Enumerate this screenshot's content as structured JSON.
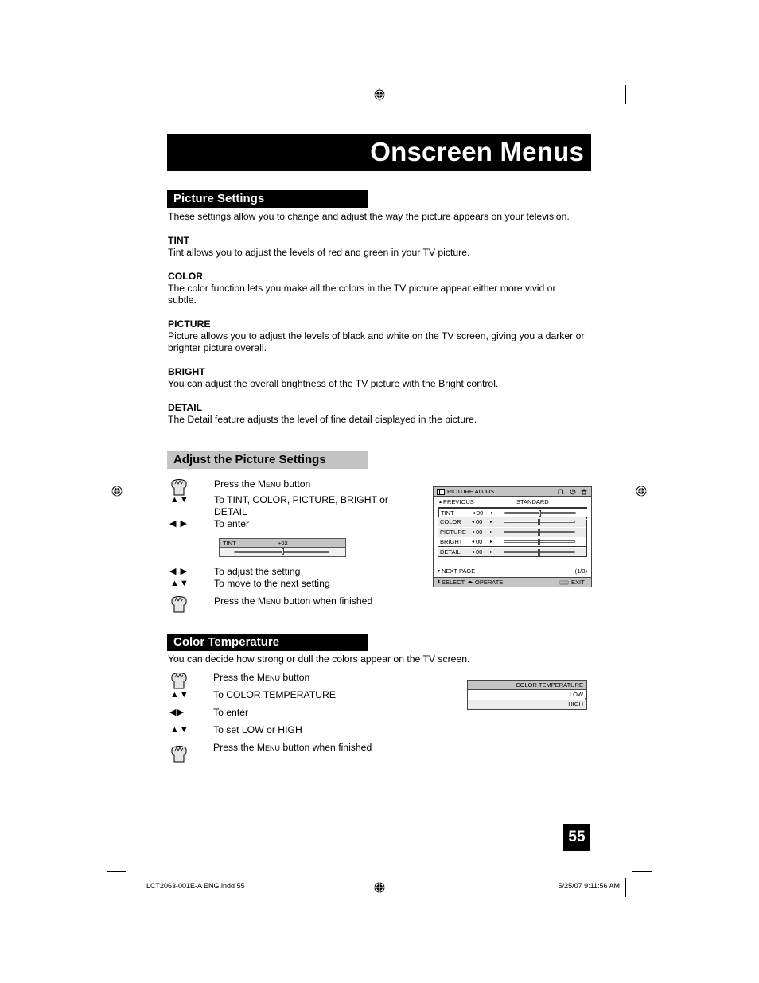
{
  "page": {
    "title": "Onscreen Menus",
    "page_number": "55"
  },
  "picture_settings": {
    "heading": "Picture Settings",
    "intro": "These settings allow you to change and adjust the way the picture appears on your television.",
    "items": [
      {
        "title": "TINT",
        "desc": "Tint allows you to adjust the levels of red and green in your TV picture."
      },
      {
        "title": "COLOR",
        "desc": "The color function lets you make all the colors in the TV picture appear either more vivid or subtle."
      },
      {
        "title": "PICTURE",
        "desc": "Picture allows you to adjust the levels of black and white on the TV screen, giving you a darker or brighter picture overall."
      },
      {
        "title": "BRIGHT",
        "desc": "You can adjust the overall brightness of the TV picture with the Bright control."
      },
      {
        "title": "DETAIL",
        "desc": "The Detail feature adjusts the level of fine detail displayed in the picture."
      }
    ]
  },
  "adjust_section": {
    "heading": "Adjust the Picture Settings",
    "steps": [
      {
        "icon": "hand-press-icon",
        "pre": "Press the ",
        "menu": "Menu",
        "post": " button"
      },
      {
        "icon": "up-down-arrows",
        "arrows": "▲▼",
        "text": "To TINT, COLOR, PICTURE, BRIGHT or DETAIL"
      },
      {
        "icon": "left-right-arrows",
        "arrows": "◀ ▶",
        "text": "To enter"
      },
      {
        "icon": "left-right-arrows",
        "arrows": "◀ ▶",
        "text": "To adjust the setting"
      },
      {
        "icon": "up-down-arrows",
        "arrows": "▲▼",
        "text": "To move to the next setting"
      },
      {
        "icon": "hand-press-icon",
        "pre": "Press the ",
        "menu": "Menu",
        "post": " button when finished"
      }
    ],
    "tint_menu": {
      "label": "TINT",
      "value": "+02",
      "level": 0.52
    },
    "picture_adjust_osd": {
      "title": "PICTURE ADJUST",
      "previous": "PREVIOUS",
      "mode": "STANDARD",
      "rows": [
        {
          "name": "TINT",
          "value": "00",
          "level": 0.5
        },
        {
          "name": "COLOR",
          "value": "00",
          "level": 0.5
        },
        {
          "name": "PICTURE",
          "value": "00",
          "level": 0.5
        },
        {
          "name": "BRIGHT",
          "value": "00",
          "level": 0.5
        },
        {
          "name": "DETAIL",
          "value": "00",
          "level": 0.5
        }
      ],
      "next_page": "NEXT PAGE",
      "page_indicator": "(1/3)",
      "select_label": "SELECT",
      "operate_label": "OPERATE",
      "menu_badge": "MENU",
      "exit_label": "EXIT"
    }
  },
  "color_temp_section": {
    "heading": "Color Temperature",
    "intro": "You can decide how strong or dull the colors appear on the TV screen.",
    "steps": [
      {
        "icon": "hand-press-icon",
        "pre": "Press the ",
        "menu": "Menu",
        "post": " button"
      },
      {
        "icon": "up-down-arrows",
        "arrows": "▲▼",
        "text": "To COLOR TEMPERATURE"
      },
      {
        "icon": "left-right-arrows",
        "arrows": "◀▶",
        "text": "To enter"
      },
      {
        "icon": "up-down-arrows",
        "arrows": "▲▼",
        "text": "To set LOW or HIGH"
      },
      {
        "icon": "hand-press-icon",
        "pre": "Press the ",
        "menu": "Menu",
        "post": " button when finished"
      }
    ],
    "osd": {
      "title": "COLOR TEMPERATURE",
      "options": [
        "LOW",
        "HIGH"
      ]
    }
  },
  "footer": {
    "file": "LCT2063-001E-A ENG.indd   55",
    "timestamp": "5/25/07   9:11:56 AM"
  }
}
